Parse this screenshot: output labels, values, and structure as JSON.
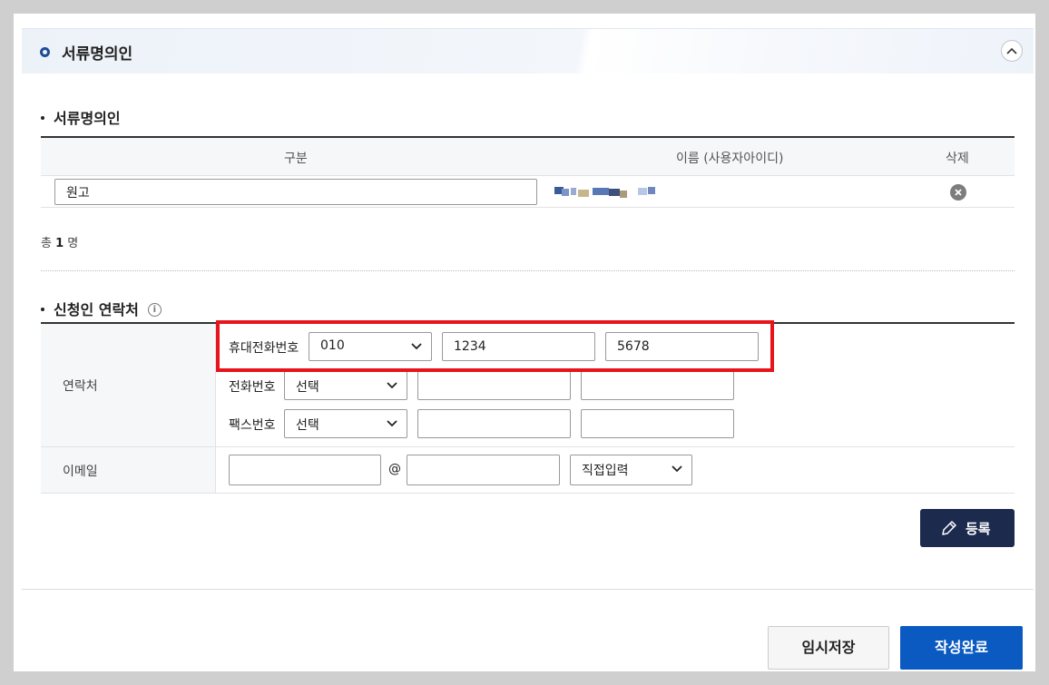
{
  "panel": {
    "title": "서류명의인"
  },
  "section1": {
    "title": "서류명의인",
    "headers": {
      "category": "구분",
      "name": "이름 (사용자아이디)",
      "delete": "삭제"
    },
    "row": {
      "category_value": "원고"
    },
    "total_prefix": "총",
    "total_count": "1",
    "total_suffix": "명"
  },
  "section2": {
    "title": "신청인 연락처",
    "contact_label": "연락처",
    "mobile": {
      "label": "휴대전화번호",
      "prefix": "010",
      "middle": "1234",
      "last": "5678"
    },
    "phone": {
      "label": "전화번호",
      "prefix": "선택",
      "middle": "",
      "last": ""
    },
    "fax": {
      "label": "팩스번호",
      "prefix": "선택",
      "middle": "",
      "last": ""
    },
    "email": {
      "label": "이메일",
      "at": "@",
      "local": "",
      "domain": "",
      "domain_select": "직접입력"
    }
  },
  "buttons": {
    "register": "등록",
    "temp_save": "임시저장",
    "complete": "작성완료"
  },
  "colors": {
    "highlight": "#e8141c",
    "primary": "#0a5ac1",
    "dark": "#1c2a4e"
  }
}
